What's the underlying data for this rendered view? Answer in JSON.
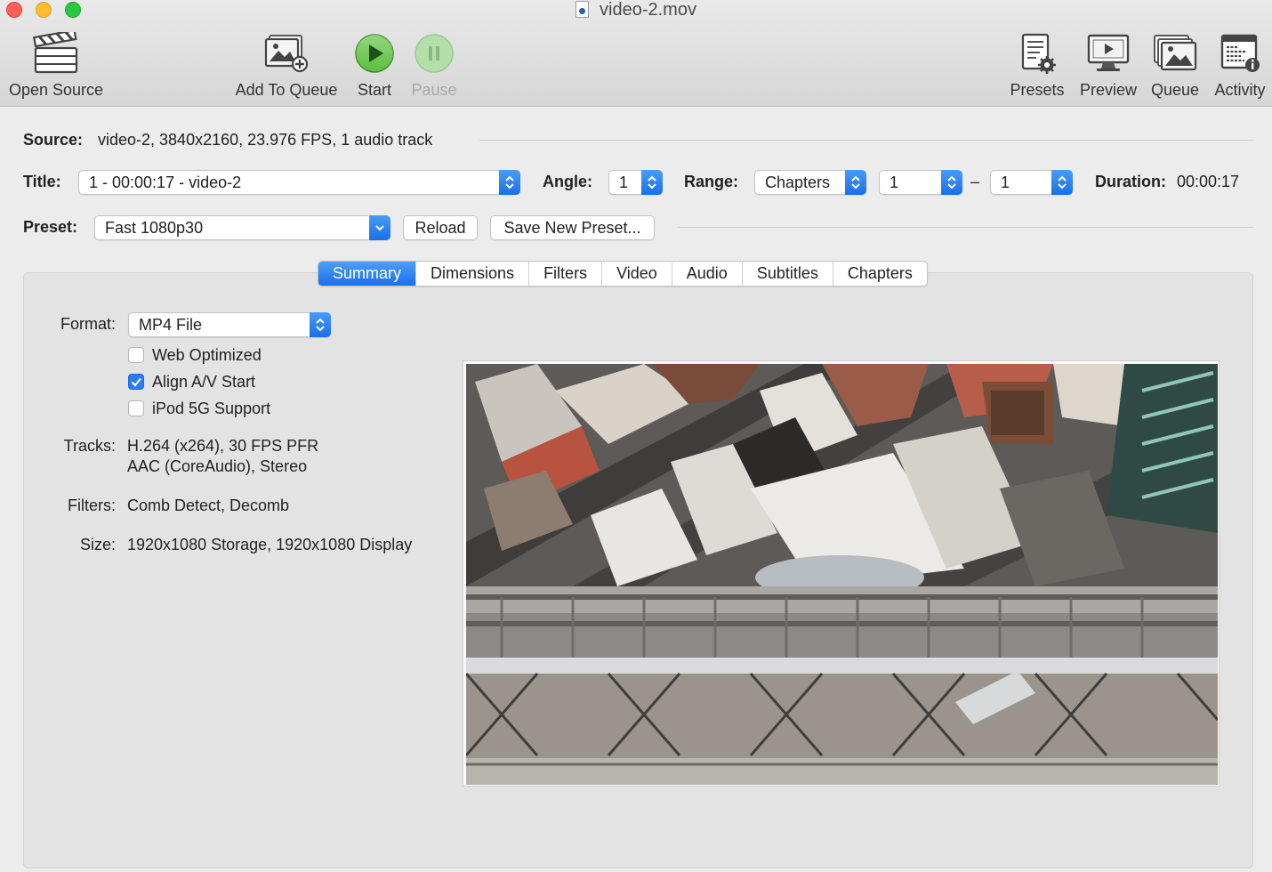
{
  "window": {
    "title": "video-2.mov"
  },
  "toolbar": {
    "open_source": "Open Source",
    "add_to_queue": "Add To Queue",
    "start": "Start",
    "pause": "Pause",
    "presets": "Presets",
    "preview": "Preview",
    "queue": "Queue",
    "activity": "Activity"
  },
  "source": {
    "label": "Source:",
    "value": "video-2, 3840x2160, 23.976 FPS, 1 audio track"
  },
  "title_row": {
    "title_label": "Title:",
    "title_value": "1 - 00:00:17 - video-2",
    "angle_label": "Angle:",
    "angle_value": "1",
    "range_label": "Range:",
    "range_mode": "Chapters",
    "range_start": "1",
    "range_dash": "–",
    "range_end": "1",
    "duration_label": "Duration:",
    "duration_value": "00:00:17"
  },
  "preset_row": {
    "label": "Preset:",
    "value": "Fast 1080p30",
    "reload": "Reload",
    "save_new": "Save New Preset..."
  },
  "tabs": [
    "Summary",
    "Dimensions",
    "Filters",
    "Video",
    "Audio",
    "Subtitles",
    "Chapters"
  ],
  "summary": {
    "format_label": "Format:",
    "format_value": "MP4 File",
    "web_optimized": "Web Optimized",
    "align_av": "Align A/V Start",
    "ipod": "iPod 5G Support",
    "web_optimized_checked": false,
    "align_av_checked": true,
    "ipod_checked": false,
    "tracks_label": "Tracks:",
    "tracks_line1": "H.264 (x264), 30 FPS PFR",
    "tracks_line2": "AAC (CoreAudio), Stereo",
    "filters_label": "Filters:",
    "filters_value": "Comb Detect, Decomb",
    "size_label": "Size:",
    "size_value": "1920x1080 Storage, 1920x1080 Display"
  },
  "colors": {
    "accent": "#1b6fe7",
    "start_green": "#3ea82f"
  }
}
